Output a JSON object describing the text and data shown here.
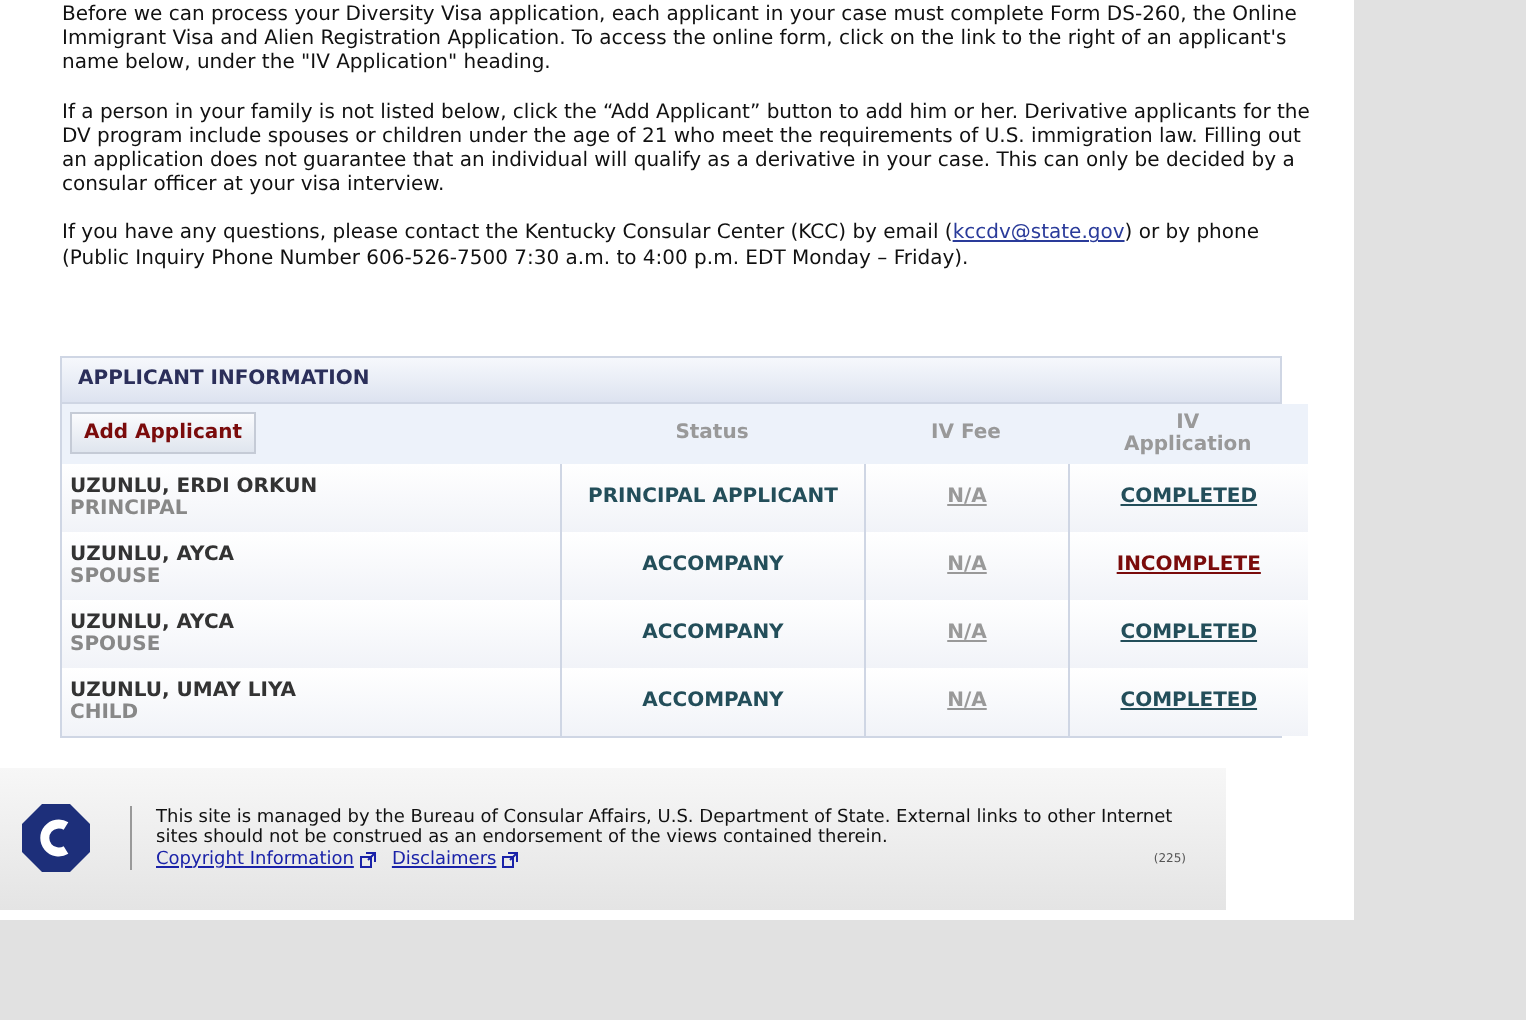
{
  "intro": {
    "paragraphs": [
      {
        "text": "Before we can process your Diversity Visa application, each applicant in your case must complete Form DS-260, the Online Immigrant Visa and Alien Registration Application. To access the online form, click on the link to the right of an applicant's name below, under the \"IV Application\" heading."
      },
      {
        "text": "If a person in your family is not listed below, click the “Add Applicant” button to add him or her. Derivative applicants for the DV program include spouses or children under the age of 21 who meet the requirements of U.S. immigration law. Filling out an application does not guarantee that an individual will qualify as a derivative in your case. This can only be decided by a consular officer at your visa interview."
      },
      {
        "text": "If you have any questions, please contact the Kentucky Consular Center (KCC) by email (",
        "link": "kccdv@state.gov",
        "after": ") or by phone (Public Inquiry Phone Number 606-526-7500 7:30 a.m. to 4:00 p.m. EDT Monday – Friday)."
      }
    ]
  },
  "applicant_table": {
    "title": "APPLICANT INFORMATION",
    "add_button": "Add Applicant",
    "columns": [
      "Status",
      "IV Fee",
      "IV Application"
    ],
    "rows": [
      {
        "name": "UZUNLU, ERDI ORKUN",
        "role": "PRINCIPAL",
        "status": "PRINCIPAL APPLICANT",
        "iv_fee": "N/A",
        "iv_application": "COMPLETED",
        "completed": true
      },
      {
        "name": "UZUNLU, AYCA",
        "role": "SPOUSE",
        "status": "ACCOMPANY",
        "iv_fee": "N/A",
        "iv_application": "INCOMPLETE",
        "completed": false
      },
      {
        "name": "UZUNLU, AYCA",
        "role": "SPOUSE",
        "status": "ACCOMPANY",
        "iv_fee": "N/A",
        "iv_application": "COMPLETED",
        "completed": true
      },
      {
        "name": "UZUNLU, UMAY LIYA",
        "role": "CHILD",
        "status": "ACCOMPANY",
        "iv_fee": "N/A",
        "iv_application": "COMPLETED",
        "completed": true
      }
    ]
  },
  "footer": {
    "text": "This site is managed by the Bureau of Consular Affairs, U.S. Department of State. External links to other Internet sites should not be construed as an endorsement of the views contained therein.",
    "links": [
      "Copyright Information",
      "Disclaimers"
    ],
    "code": "(225)"
  }
}
